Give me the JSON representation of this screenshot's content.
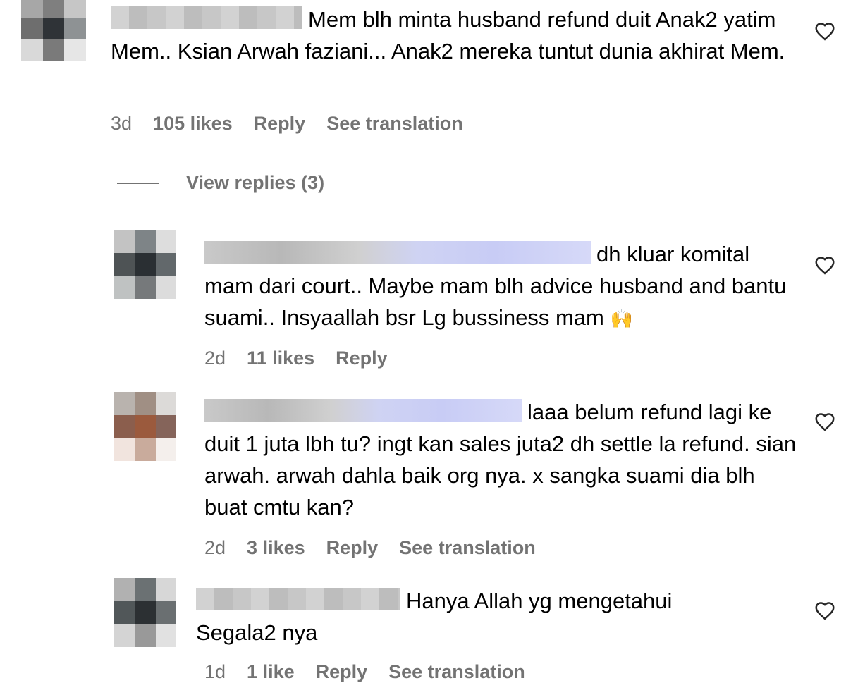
{
  "comments": [
    {
      "text": "Mem blh minta husband refund duit Anak2 yatim Mem.. Ksian Arwah faziani... Anak2 mereka tuntut dunia akhirat Mem.",
      "time": "3d",
      "likes": "105 likes",
      "reply": "Reply",
      "translate": "See translation"
    },
    {
      "text": "dh kluar komital mam dari court.. Maybe mam blh advice husband and bantu suami.. Insyaallah bsr Lg bussiness mam",
      "emoji": "🙌",
      "time": "2d",
      "likes": "11 likes",
      "reply": "Reply"
    },
    {
      "text": "laaa belum refund lagi ke duit 1 juta lbh tu? ingt kan sales juta2 dh settle la refund. sian arwah. arwah dahla baik org nya. x sangka suami dia blh buat cmtu kan?",
      "time": "2d",
      "likes": "3 likes",
      "reply": "Reply",
      "translate": "See translation"
    },
    {
      "text": "Hanya Allah yg mengetahui Segala2 nya",
      "time": "1d",
      "likes": "1 like",
      "reply": "Reply",
      "translate": "See translation"
    }
  ],
  "view_replies": "View replies (3)",
  "colors": {
    "meta_text": "#737373",
    "body_text": "#000000",
    "mention_blue": "#c8ccf5"
  },
  "icons": {
    "like": "heart-outline-icon"
  }
}
